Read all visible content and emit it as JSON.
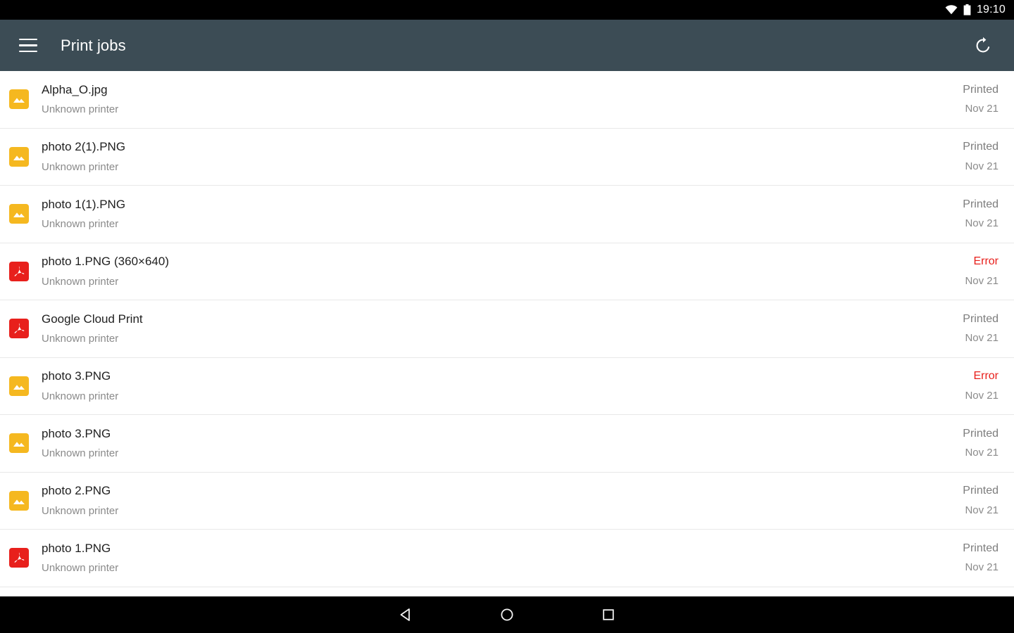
{
  "status_bar": {
    "wifi_icon": "wifi-icon",
    "battery_icon": "battery-icon",
    "time": "19:10"
  },
  "toolbar": {
    "menu_icon": "hamburger-menu-icon",
    "title": "Print jobs",
    "refresh_icon": "refresh-icon"
  },
  "colors": {
    "toolbar_bg": "#3c4c55",
    "image_icon": "#f5b820",
    "pdf_icon": "#e8201c",
    "error_text": "#e8201c",
    "status_bar_bg": "#000000"
  },
  "jobs": [
    {
      "icon": "image-file-icon",
      "type": "image",
      "title": "Alpha_O.jpg",
      "printer": "Unknown printer",
      "status": "Printed",
      "error": false,
      "date": "Nov 21"
    },
    {
      "icon": "image-file-icon",
      "type": "image",
      "title": "photo 2(1).PNG",
      "printer": "Unknown printer",
      "status": "Printed",
      "error": false,
      "date": "Nov 21"
    },
    {
      "icon": "image-file-icon",
      "type": "image",
      "title": "photo 1(1).PNG",
      "printer": "Unknown printer",
      "status": "Printed",
      "error": false,
      "date": "Nov 21"
    },
    {
      "icon": "pdf-file-icon",
      "type": "pdf",
      "title": "photo 1.PNG (360×640)",
      "printer": "Unknown printer",
      "status": "Error",
      "error": true,
      "date": "Nov 21"
    },
    {
      "icon": "pdf-file-icon",
      "type": "pdf",
      "title": "Google Cloud Print",
      "printer": "Unknown printer",
      "status": "Printed",
      "error": false,
      "date": "Nov 21"
    },
    {
      "icon": "image-file-icon",
      "type": "image",
      "title": "photo 3.PNG",
      "printer": "Unknown printer",
      "status": "Error",
      "error": true,
      "date": "Nov 21"
    },
    {
      "icon": "image-file-icon",
      "type": "image",
      "title": "photo 3.PNG",
      "printer": "Unknown printer",
      "status": "Printed",
      "error": false,
      "date": "Nov 21"
    },
    {
      "icon": "image-file-icon",
      "type": "image",
      "title": "photo 2.PNG",
      "printer": "Unknown printer",
      "status": "Printed",
      "error": false,
      "date": "Nov 21"
    },
    {
      "icon": "pdf-file-icon",
      "type": "pdf",
      "title": "photo 1.PNG",
      "printer": "Unknown printer",
      "status": "Printed",
      "error": false,
      "date": "Nov 21"
    }
  ],
  "nav_bar": {
    "back_icon": "back-triangle-icon",
    "home_icon": "home-circle-icon",
    "recents_icon": "recents-square-icon"
  }
}
